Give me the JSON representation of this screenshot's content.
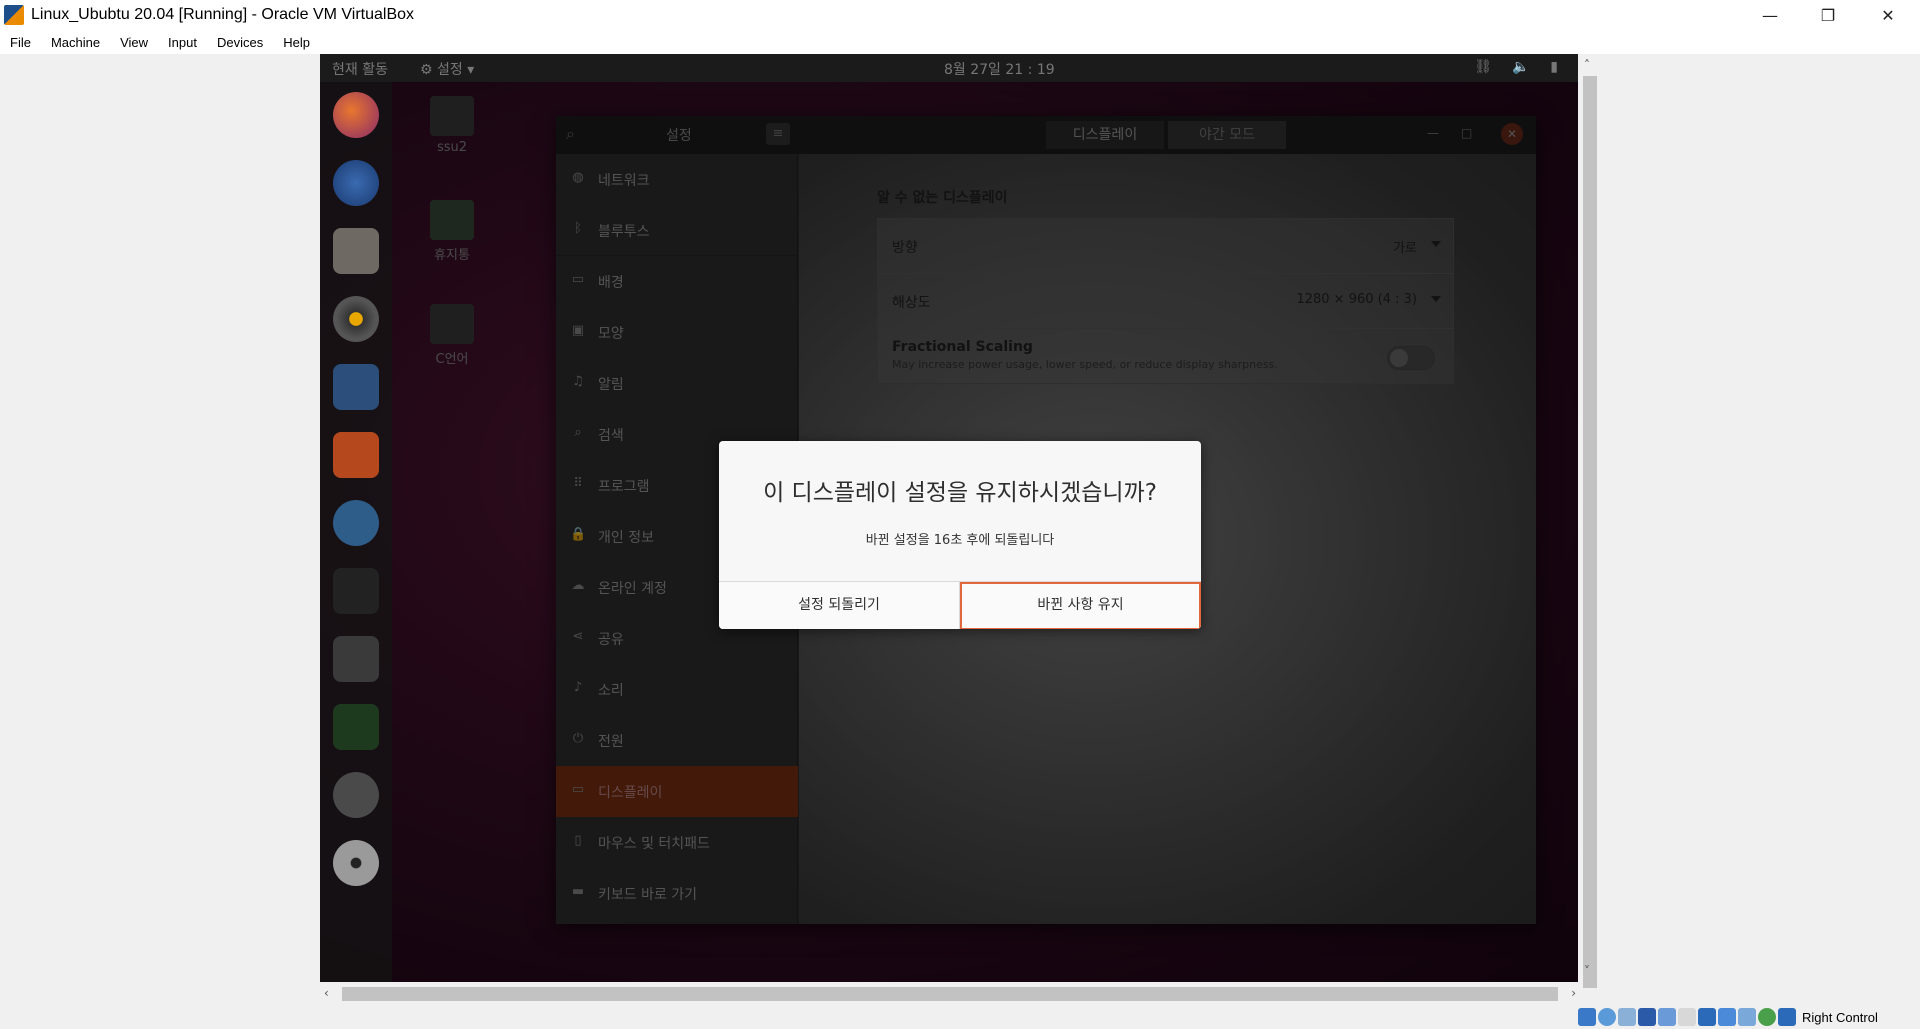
{
  "window": {
    "title": "Linux_Ububtu 20.04 [Running] - Oracle VM VirtualBox",
    "minimize_icon": "—",
    "restore_icon": "❐",
    "close_icon": "✕"
  },
  "menu": [
    "File",
    "Machine",
    "View",
    "Input",
    "Devices",
    "Help"
  ],
  "vm": {
    "topbar": {
      "activities": "현재 활동",
      "app_menu": "⚙ 설정 ▾",
      "clock": "8월 27일  21 : 19",
      "tray": "⛓ 🔈 ▮"
    },
    "desktop_icons": [
      "ssu2",
      "휴지통",
      "C언어"
    ],
    "settings": {
      "title": "설정",
      "tabs": [
        "디스플레이",
        "야간 모드"
      ],
      "sidebar": [
        {
          "icon": "network-icon",
          "glyph": "◍",
          "label": "네트워크"
        },
        {
          "icon": "bluetooth-icon",
          "glyph": "ᛒ",
          "label": "블루투스"
        },
        {
          "icon": "background-icon",
          "glyph": "▭",
          "label": "배경"
        },
        {
          "icon": "appearance-icon",
          "glyph": "▣",
          "label": "모양"
        },
        {
          "icon": "bell-icon",
          "glyph": "♫",
          "label": "알림"
        },
        {
          "icon": "search-icon",
          "glyph": "⌕",
          "label": "검색"
        },
        {
          "icon": "apps-icon",
          "glyph": "⠿",
          "label": "프로그램"
        },
        {
          "icon": "lock-icon",
          "glyph": "🔒",
          "label": "개인 정보"
        },
        {
          "icon": "cloud-icon",
          "glyph": "☁",
          "label": "온라인 계정"
        },
        {
          "icon": "share-icon",
          "glyph": "⋖",
          "label": "공유"
        },
        {
          "icon": "music-icon",
          "glyph": "♪",
          "label": "소리"
        },
        {
          "icon": "power-icon",
          "glyph": "⏻",
          "label": "전원"
        },
        {
          "icon": "display-icon",
          "glyph": "▭",
          "label": "디스플레이"
        },
        {
          "icon": "mouse-icon",
          "glyph": "▯",
          "label": "마우스 및 터치패드"
        },
        {
          "icon": "keyboard-icon",
          "glyph": "▬",
          "label": "키보드 바로 가기"
        }
      ],
      "selected_item": "디스플레이",
      "display": {
        "heading": "알 수 없는 디스플레이",
        "orientation_label": "방향",
        "orientation_value": "가로",
        "resolution_label": "해상도",
        "resolution_value": "1280 × 960 (4 : 3)",
        "fractional_title": "Fractional Scaling",
        "fractional_subtitle": "May increase power usage, lower speed, or reduce display sharpness.",
        "fractional_enabled": false
      }
    },
    "dialog": {
      "title": "이 디스플레이 설정을 유지하시겠습니까?",
      "message": "바뀐 설정을 16초 후에 되돌립니다",
      "revert_label": "설정 되돌리기",
      "keep_label": "바뀐 사항 유지",
      "accent_color": "#e2683c"
    }
  },
  "statusbar": {
    "host_key": "Right Control"
  }
}
